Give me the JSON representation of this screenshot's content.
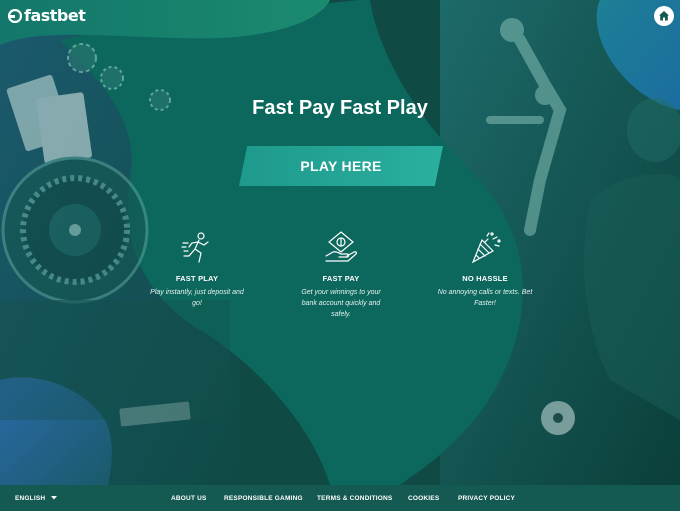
{
  "brand": {
    "name": "fastbet"
  },
  "header": {
    "home_icon": "home-icon"
  },
  "hero": {
    "headline": "Fast Pay Fast Play",
    "cta_label": "PLAY HERE"
  },
  "features": [
    {
      "icon": "runner-icon",
      "title": "FAST PLAY",
      "desc": [
        "Play instantly, just deposit and",
        "go!"
      ]
    },
    {
      "icon": "money-hand-icon",
      "title": "FAST PAY",
      "desc": [
        "Get your winnings to your",
        "bank account quickly and",
        "safely."
      ]
    },
    {
      "icon": "party-popper-icon",
      "title": "NO HASSLE",
      "desc": [
        "No annoying calls or texts. Bet",
        "Faster!"
      ]
    }
  ],
  "footer": {
    "language": "ENGLISH",
    "links": [
      "ABOUT US",
      "RESPONSIBLE GAMING",
      "TERMS & CONDITIONS",
      "COOKIES",
      "PRIVACY POLICY"
    ]
  },
  "colors": {
    "background": "#0f4a45",
    "blob": "#0d6a60",
    "cta": "#25a595",
    "footer": "#155a52"
  }
}
